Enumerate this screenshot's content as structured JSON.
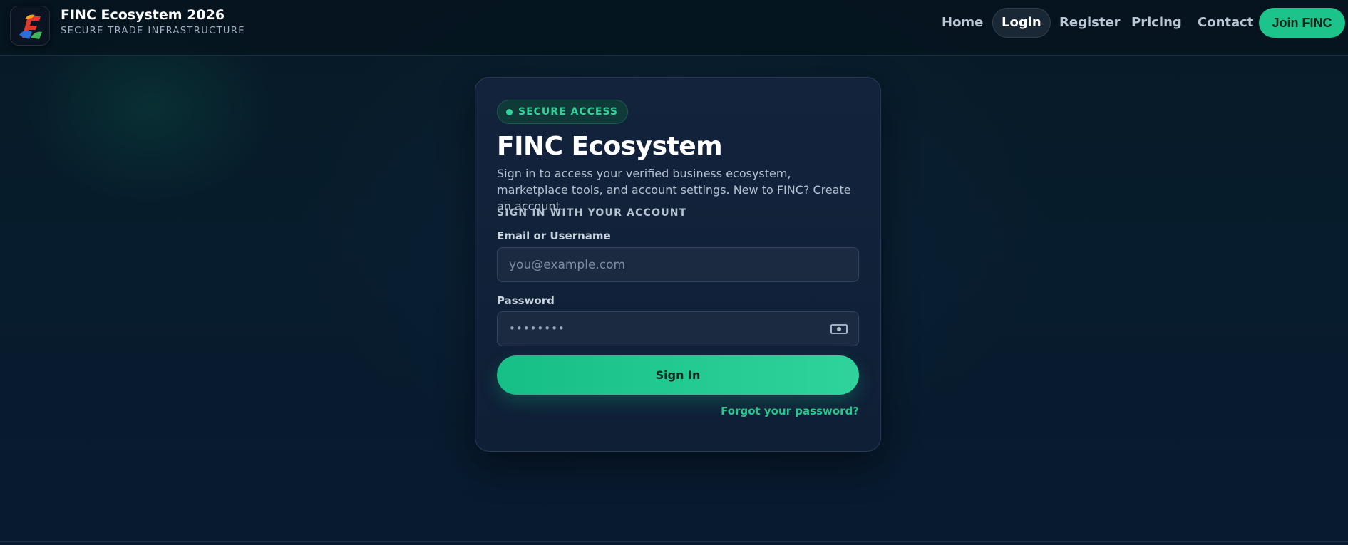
{
  "brand": {
    "title": "FINC Ecosystem 2026",
    "subtitle": "SECURE TRADE INFRASTRUCTURE",
    "logo_icon": "finc-logo-icon"
  },
  "nav": {
    "items": [
      "Home",
      "Login",
      "Register",
      "Pricing",
      "Contact"
    ],
    "active": "Login",
    "cta_label": "Join FINC"
  },
  "card": {
    "badge": "SECURE ACCESS",
    "title": "FINC Ecosystem",
    "description": "Sign in to access your verified business ecosystem, marketplace tools, and account settings. New to FINC? Create an account.",
    "section_label": "SIGN IN WITH YOUR ACCOUNT",
    "email": {
      "label": "Email or Username",
      "placeholder": "you@example.com",
      "value": ""
    },
    "password": {
      "label": "Password",
      "masked_value": "••••••••",
      "toggle_icon": "eye-icon"
    },
    "submit_label": "Sign In",
    "forgot_label": "Forgot your password?"
  },
  "colors": {
    "accent": "#1cc38a",
    "background": "#071a26",
    "card": "#13233b"
  }
}
